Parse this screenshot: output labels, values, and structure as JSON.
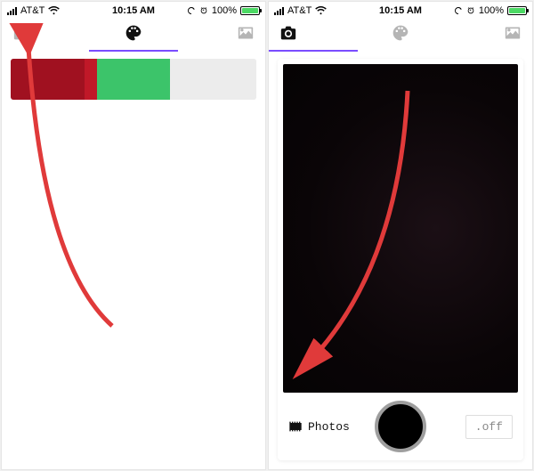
{
  "status": {
    "carrier": "AT&T",
    "time": "10:15 AM",
    "battery_pct": "100%"
  },
  "left": {
    "swatches": [
      {
        "color": "#a01120",
        "width_pct": 30
      },
      {
        "color": "#c01828",
        "width_pct": 5
      },
      {
        "color": "#3cc46a",
        "width_pct": 30
      },
      {
        "color": "#ececec",
        "width_pct": 35
      }
    ]
  },
  "right": {
    "photos_label": "Photos",
    "flash_label": ".off"
  },
  "icons": {
    "camera": "camera-icon",
    "palette": "palette-icon",
    "image": "image-icon",
    "film": "film-icon"
  }
}
